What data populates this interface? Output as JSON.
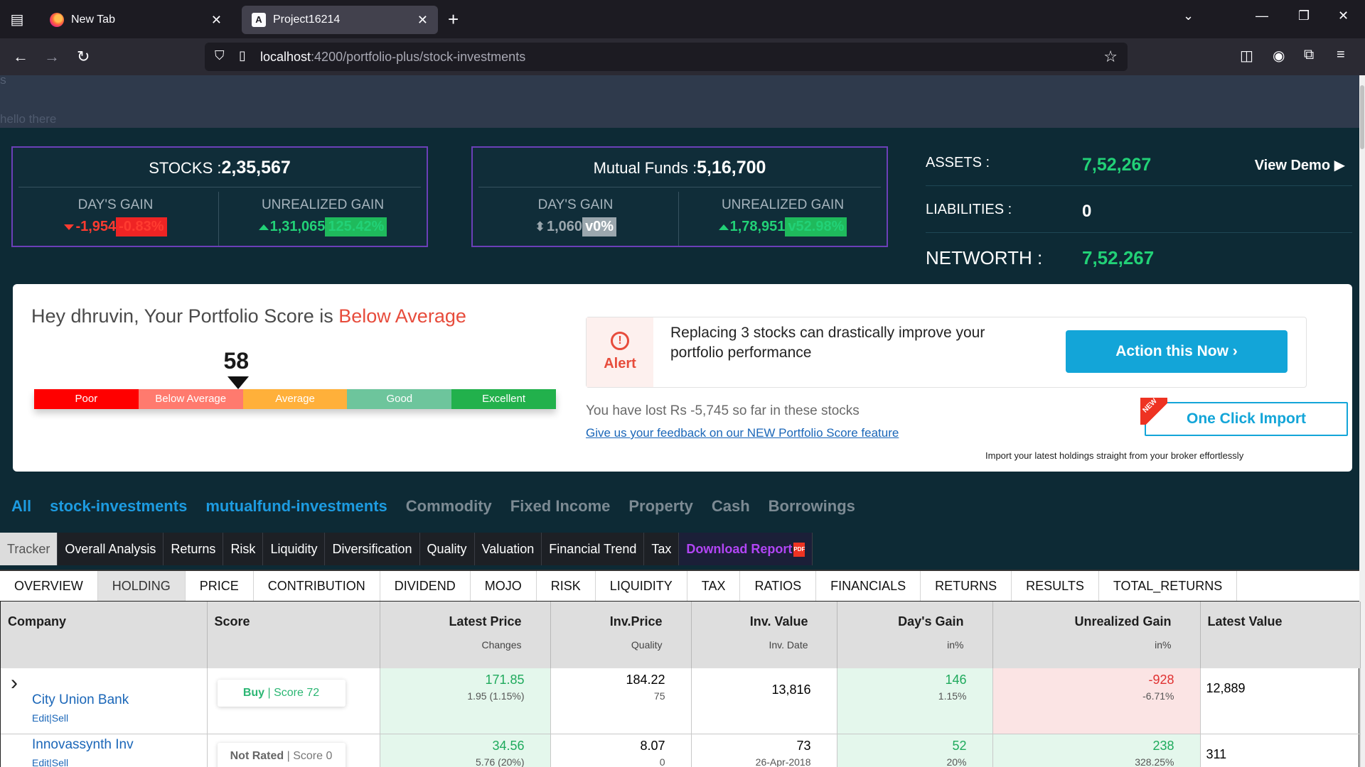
{
  "browser": {
    "tabs": [
      {
        "title": "New Tab"
      },
      {
        "title": "Project16214"
      }
    ],
    "url_host": "localhost",
    "url_path": ":4200/portfolio-plus/stock-investments"
  },
  "strip": {
    "s": "S",
    "hello": "hello there"
  },
  "stocks": {
    "title": "STOCKS :",
    "total": "2,35,567",
    "days_gain_label": "DAY'S GAIN",
    "days_gain_value": "-1,954",
    "days_gain_pct": "-0.83%",
    "unreal_label": "UNREALIZED GAIN",
    "unreal_value": "1,31,065",
    "unreal_pct": "125.42%"
  },
  "mutual": {
    "title": "Mutual Funds :",
    "total": "5,16,700",
    "days_gain_label": "DAY'S GAIN",
    "days_gain_value": "1,060",
    "days_gain_pct": "v0%",
    "unreal_label": "UNREALIZED GAIN",
    "unreal_value": "1,78,951",
    "unreal_pct": "v52.98%"
  },
  "summary": {
    "assets_label": "ASSETS :",
    "assets_value": "7,52,267",
    "view_demo": "View Demo",
    "liabilities_label": "LIABILITIES :",
    "liabilities_value": "0",
    "networth_label": "NETWORTH :",
    "networth_value": "7,52,267"
  },
  "score": {
    "title_prefix": "Hey dhruvin, Your Portfolio Score is ",
    "title_rating": "Below Average",
    "value": "58",
    "level": 58,
    "segments": [
      {
        "label": "Poor",
        "color": "#ff0000"
      },
      {
        "label": "Below Average",
        "color": "#ff7a6e"
      },
      {
        "label": "Average",
        "color": "#ffb03a"
      },
      {
        "label": "Good",
        "color": "#6dc59c"
      },
      {
        "label": "Excellent",
        "color": "#22b14c"
      }
    ],
    "alert_word": "Alert",
    "alert_message": "Replacing 3 stocks can drastically improve your portfolio performance",
    "action_button": "Action this Now ›",
    "lost_text": "You have lost Rs -5,745 so far in these stocks",
    "feedback_link": "Give us your feedback on our NEW Portfolio Score feature",
    "import_button": "One Click Import",
    "new_badge": "NEW",
    "import_sub": "Import your latest holdings straight from your broker effortlessly"
  },
  "categories": [
    "All",
    "stock-investments",
    "mutualfund-investments",
    "Commodity",
    "Fixed Income",
    "Property",
    "Cash",
    "Borrowings"
  ],
  "analysis_tabs": [
    "Tracker",
    "Overall Analysis",
    "Returns",
    "Risk",
    "Liquidity",
    "Diversification",
    "Quality",
    "Valuation",
    "Financial Trend",
    "Tax",
    "Download Report"
  ],
  "sub_tabs": [
    "OVERVIEW",
    "HOLDING",
    "PRICE",
    "CONTRIBUTION",
    "DIVIDEND",
    "MOJO",
    "RISK",
    "LIQUIDITY",
    "TAX",
    "RATIOS",
    "FINANCIALS",
    "RETURNS",
    "RESULTS",
    "TOTAL_RETURNS"
  ],
  "table": {
    "headers": {
      "company": "Company",
      "score": "Score",
      "latest_price": "Latest Price",
      "latest_price_sub": "Changes",
      "inv_price": "Inv.Price",
      "inv_price_sub": "Quality",
      "inv_value": "Inv. Value",
      "inv_value_sub": "Inv. Date",
      "days_gain": "Day's Gain",
      "days_gain_sub": "in%",
      "unreal": "Unrealized Gain",
      "unreal_sub": "in%",
      "latest_value": "Latest Value"
    },
    "rows": [
      {
        "company": "City Union Bank",
        "edit": "Edit|Sell",
        "score_action": "Buy",
        "score_text": " | Score 72",
        "latest_price": "171.85",
        "change": "1.95 (1.15%)",
        "inv_price": "184.22",
        "quality": "75",
        "inv_value": "13,816",
        "inv_date": "",
        "days_gain": "146",
        "days_gain_pct": "1.15%",
        "unreal": "-928",
        "unreal_pct": "-6.71%",
        "latest_value": "12,889"
      },
      {
        "company": "Innovassynth Inv",
        "edit": "Edit|Sell",
        "score_action": "Not Rated",
        "score_text": " | Score 0",
        "latest_price": "34.56",
        "change": "5.76 (20%)",
        "inv_price": "8.07",
        "quality": "0",
        "inv_value": "73",
        "inv_date": "26-Apr-2018",
        "days_gain": "52",
        "days_gain_pct": "20%",
        "unreal": "238",
        "unreal_pct": "328.25%",
        "latest_value": "311"
      }
    ]
  }
}
